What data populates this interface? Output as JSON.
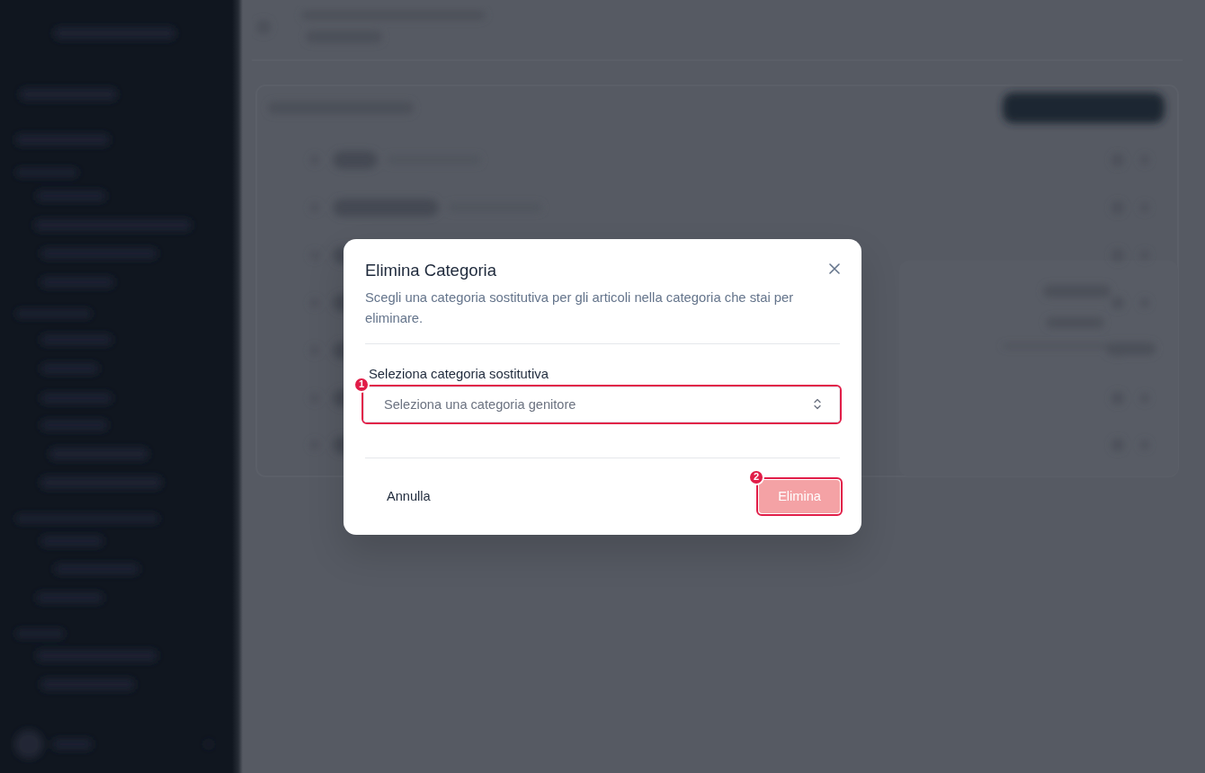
{
  "dialog": {
    "title": "Elimina Categoria",
    "description": "Scegli una categoria sostitutiva per gli articoli nella categoria che stai per eliminare.",
    "field": {
      "label": "Seleziona categoria sostitutiva",
      "placeholder": "Seleziona una categoria genitore",
      "marker": "1"
    },
    "buttons": [
      {
        "kind": "cancel",
        "label": "Annulla",
        "disabled": false
      },
      {
        "kind": "danger",
        "label": "Elimina",
        "disabled": true,
        "marker": "2"
      }
    ]
  }
}
